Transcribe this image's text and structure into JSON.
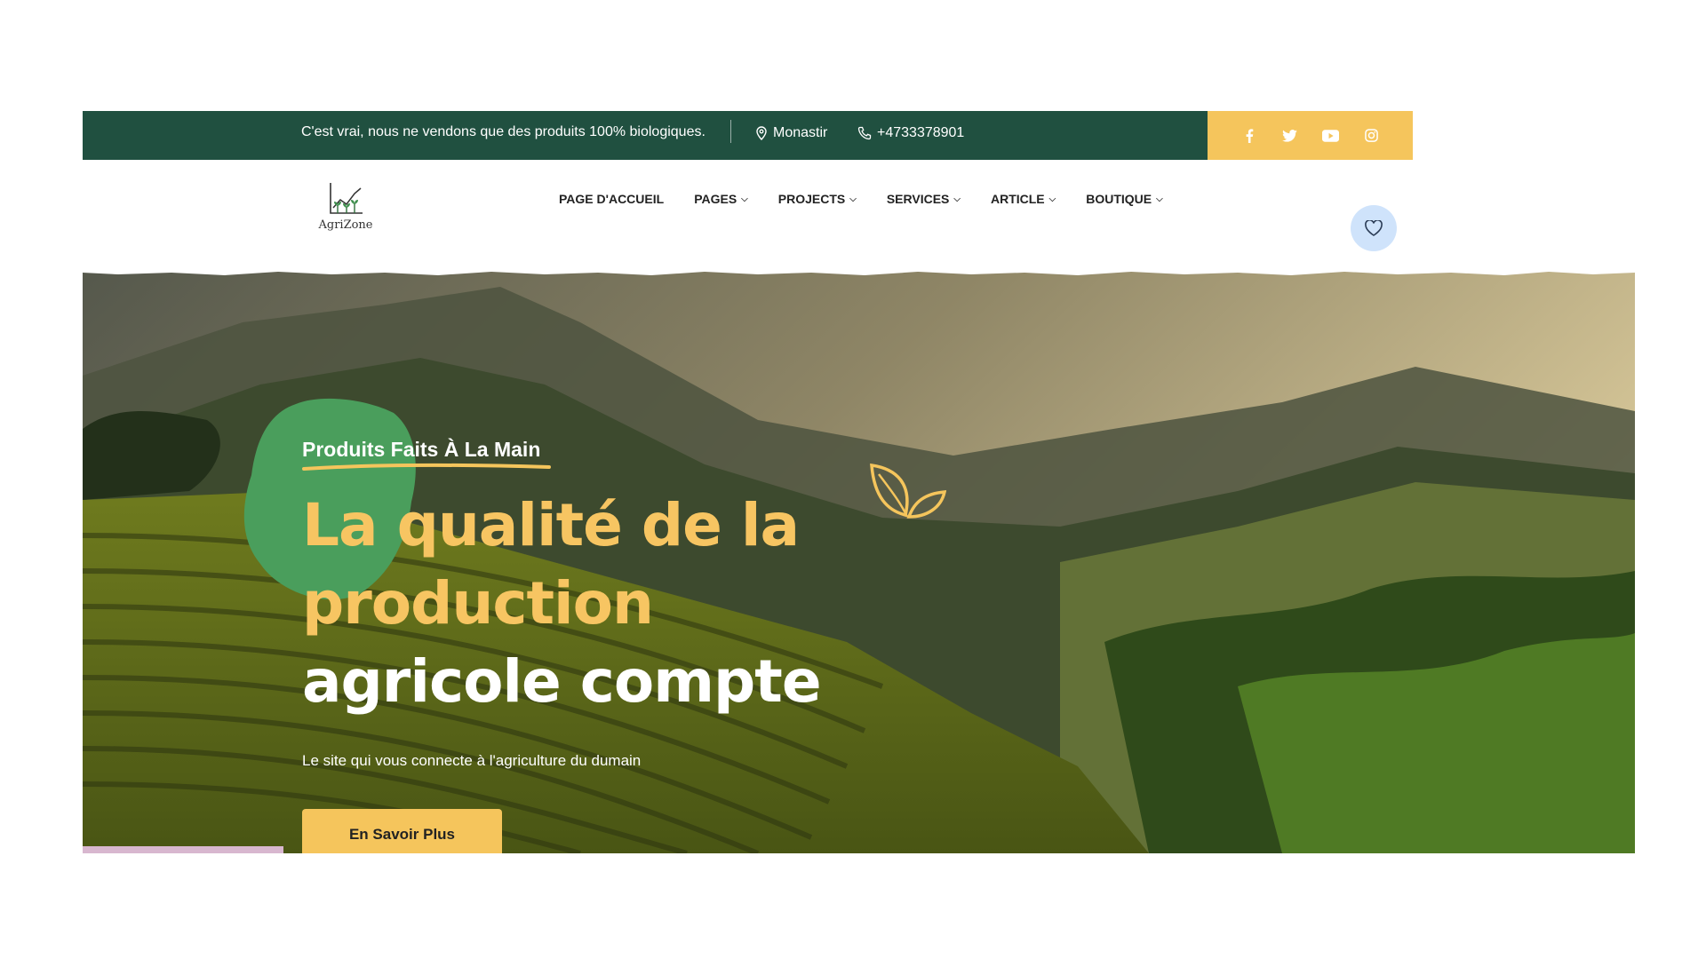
{
  "topbar": {
    "tagline": "C'est vrai, nous ne vendons que des produits 100% biologiques.",
    "location": "Monastir",
    "phone": "+4733378901",
    "social_icons": [
      "facebook-icon",
      "twitter-icon",
      "youtube-icon",
      "instagram-icon"
    ],
    "colors": {
      "green": "#205040",
      "yellow": "#f5c55c"
    }
  },
  "nav": {
    "logo_text": "AgriZone",
    "items": [
      {
        "label": "PAGE D'ACCUEIL",
        "dropdown": false
      },
      {
        "label": "PAGES",
        "dropdown": true
      },
      {
        "label": "PROJECTS",
        "dropdown": true
      },
      {
        "label": "SERVICES",
        "dropdown": true
      },
      {
        "label": "ARTICLE",
        "dropdown": true
      },
      {
        "label": "BOUTIQUE",
        "dropdown": true
      }
    ],
    "favorite_icon": "heart-icon"
  },
  "hero": {
    "kicker": "Produits Faits À La Main",
    "headline_line1": "La qualité de la",
    "headline_line2": "production",
    "headline_line3": "agricole compte",
    "subtitle": "Le site qui vous connecte à l'agriculture du dumain",
    "cta": "En Savoir Plus",
    "accent_color": "#f7c562",
    "blob_color": "#4a9e5c"
  }
}
